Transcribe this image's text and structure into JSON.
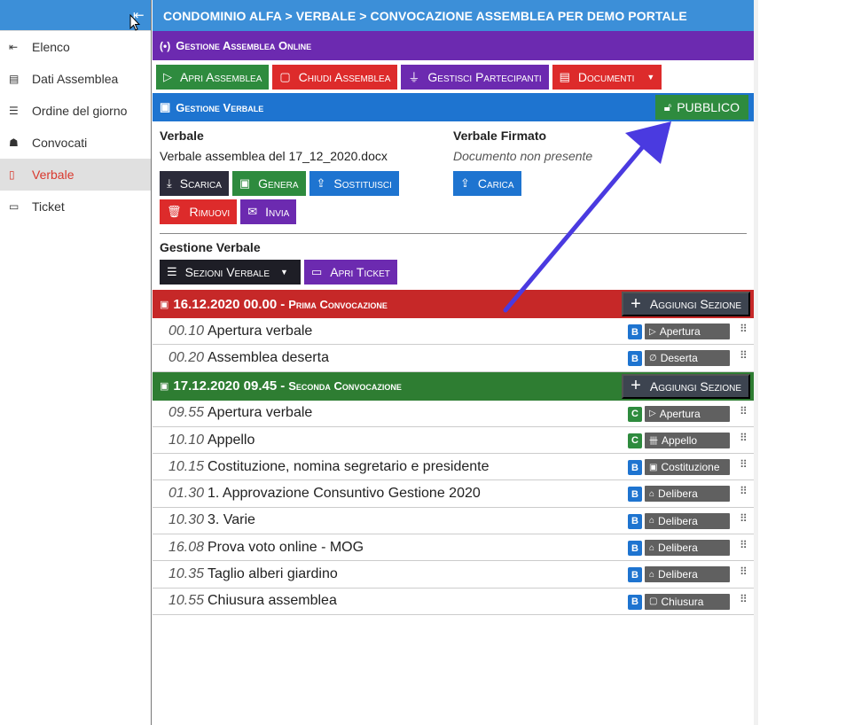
{
  "sidebar": {
    "collapse_icon": "collapse-left-icon",
    "items": [
      {
        "label": "Elenco",
        "icon": "back-icon",
        "glyph": "⇤"
      },
      {
        "label": "Dati Assemblea",
        "icon": "id-card-icon",
        "glyph": "▤"
      },
      {
        "label": "Ordine del giorno",
        "icon": "list-icon",
        "glyph": "☰"
      },
      {
        "label": "Convocati",
        "icon": "users-icon",
        "glyph": "☗"
      },
      {
        "label": "Verbale",
        "icon": "document-icon",
        "glyph": "▯"
      },
      {
        "label": "Ticket",
        "icon": "ticket-icon",
        "glyph": "▭"
      }
    ],
    "active_index": 4
  },
  "breadcrumb": "CONDOMINIO ALFA > VERBALE > CONVOCAZIONE ASSEMBLEA PER DEMO PORTALE",
  "assemblea": {
    "title": "Gestione Assemblea Online",
    "buttons": {
      "apri": "Apri Assemblea",
      "chiudi": "Chiudi Assemblea",
      "partecipanti": "Gestisci Partecipanti",
      "documenti": "Documenti"
    }
  },
  "verbale": {
    "title": "Gestione Verbale",
    "public_button": "PUBBLICO",
    "verbale_label": "Verbale",
    "verbale_file": "Verbale assemblea del 17_12_2020.docx",
    "firmato_label": "Verbale Firmato",
    "firmato_value": "Documento non presente",
    "buttons": {
      "scarica": "Scarica",
      "genera": "Genera",
      "sostituisci": "Sostituisci",
      "carica": "Carica",
      "rimuovi": "Rimuovi",
      "invia": "Invia"
    },
    "gestione_label": "Gestione Verbale",
    "sezioni_button": "Sezioni Verbale",
    "ticket_button": "Apri Ticket"
  },
  "convocazioni": [
    {
      "date": "16.12.2020 00.00",
      "name": "Prima Convocazione",
      "add_label": "Aggiungi Sezione",
      "color": "#c62828",
      "rows": [
        {
          "time": "00.10",
          "title": "Apertura verbale",
          "badge": "B",
          "tag": "Apertura",
          "tag_glyph": "▷"
        },
        {
          "time": "00.20",
          "title": "Assemblea deserta",
          "badge": "B",
          "tag": "Deserta",
          "tag_glyph": "∅"
        }
      ]
    },
    {
      "date": "17.12.2020 09.45",
      "name": "Seconda Convocazione",
      "add_label": "Aggiungi Sezione",
      "color": "#2e7d32",
      "rows": [
        {
          "time": "09.55",
          "title": "Apertura verbale",
          "badge": "C",
          "tag": "Apertura",
          "tag_glyph": "▷"
        },
        {
          "time": "10.10",
          "title": "Appello",
          "badge": "C",
          "tag": "Appello",
          "tag_glyph": "卌"
        },
        {
          "time": "10.15",
          "title": "Costituzione, nomina segretario e presidente",
          "badge": "B",
          "tag": "Costituzione",
          "tag_glyph": "▣"
        },
        {
          "time": "01.30",
          "title": "1. Approvazione Consuntivo Gestione 2020",
          "badge": "B",
          "tag": "Delibera",
          "tag_glyph": "⌂"
        },
        {
          "time": "10.30",
          "title": "3. Varie",
          "badge": "B",
          "tag": "Delibera",
          "tag_glyph": "⌂"
        },
        {
          "time": "16.08",
          "title": "Prova voto online - MOG",
          "badge": "B",
          "tag": "Delibera",
          "tag_glyph": "⌂"
        },
        {
          "time": "10.35",
          "title": "Taglio alberi giardino",
          "badge": "B",
          "tag": "Delibera",
          "tag_glyph": "⌂"
        },
        {
          "time": "10.55",
          "title": "Chiusura assemblea",
          "badge": "B",
          "tag": "Chiusura",
          "tag_glyph": "▢"
        }
      ]
    }
  ],
  "colors": {
    "topbar": "#3c8fd8",
    "purple": "#6c2ab0",
    "green": "#2e8b3e",
    "red": "#dd2b2b",
    "blue": "#1e74d0",
    "arrow": "#4a3ae0",
    "active_sidebar": "#d9382d"
  }
}
